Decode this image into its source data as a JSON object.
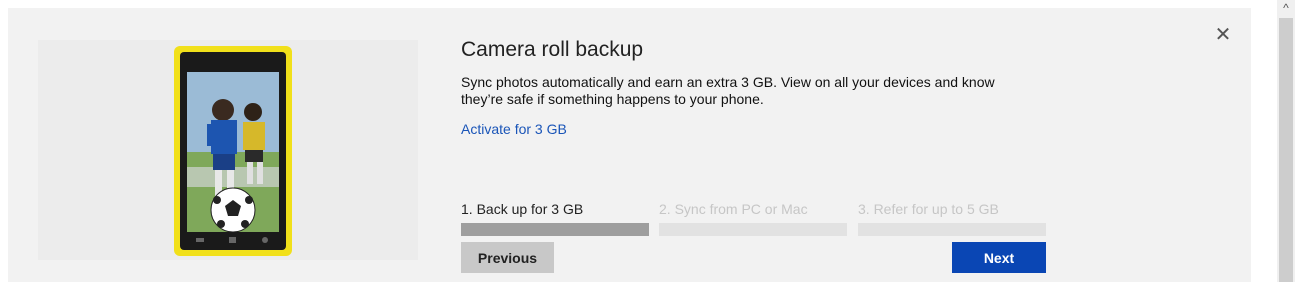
{
  "dialog": {
    "title": "Camera roll backup",
    "description": "Sync photos automatically and earn an extra 3 GB. View on all your devices and know they’re safe if something happens to your phone.",
    "activate_link": "Activate for 3 GB",
    "close_icon": "close-icon",
    "close_glyph": "✕"
  },
  "steps": [
    {
      "label": "1. Back up for 3 GB",
      "active": true
    },
    {
      "label": "2. Sync from PC or Mac",
      "active": false
    },
    {
      "label": "3. Refer for up to 5 GB",
      "active": false
    }
  ],
  "buttons": {
    "previous": "Previous",
    "next": "Next"
  },
  "colors": {
    "accent": "#0a46b4",
    "link": "#1a55b8",
    "step_active": "#9e9e9e",
    "step_inactive": "#e2e2e2",
    "phone": "#f1e01a"
  },
  "scrollbar": {
    "up_arrow": "^"
  }
}
